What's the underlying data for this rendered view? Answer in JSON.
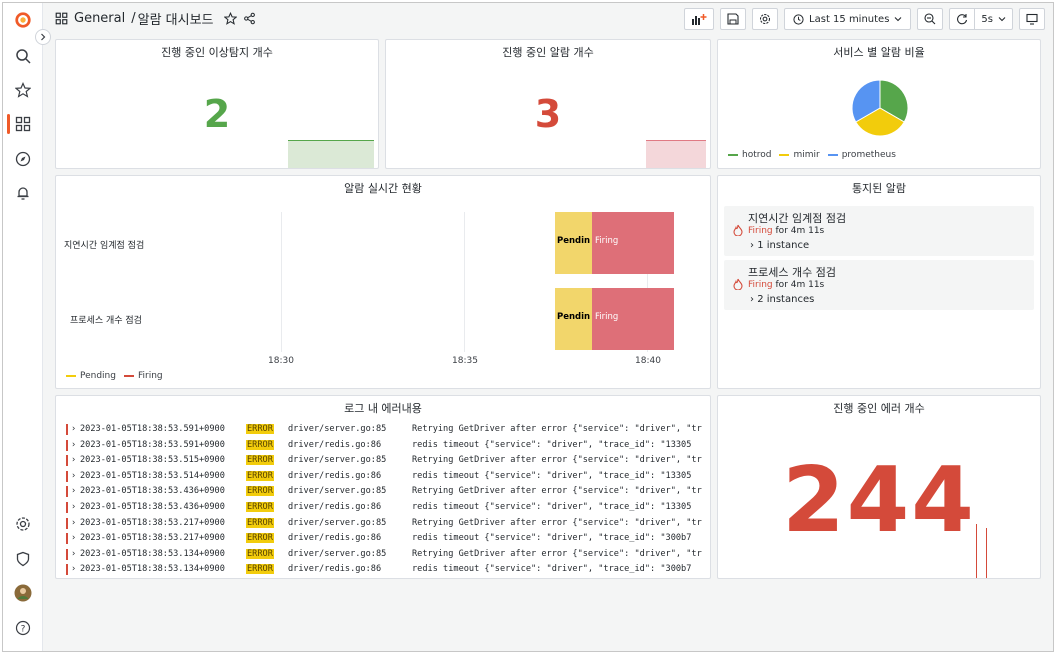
{
  "breadcrumb": {
    "folder": "General",
    "separator": "/",
    "dashboard": "알람 대시보드"
  },
  "toolbar": {
    "time_range": "Last 15 minutes",
    "refresh": "5s"
  },
  "panels": {
    "anomaly": {
      "title": "진행 중인 이상탐지 개수",
      "value": "2",
      "color": "#56a64b"
    },
    "alerts": {
      "title": "진행 중인 알람 개수",
      "value": "3",
      "color": "#d44a3a"
    },
    "service_ratio": {
      "title": "서비스 별 알람 비율",
      "legend": [
        {
          "name": "hotrod",
          "color": "#56a64b"
        },
        {
          "name": "mimir",
          "color": "#f2cc0c"
        },
        {
          "name": "prometheus",
          "color": "#5794f2"
        }
      ]
    },
    "realtime": {
      "title": "알람 실시간 현황",
      "rows": [
        {
          "label": "지연시간 임계점 점검",
          "pending": "Pendin",
          "firing": "Firing"
        },
        {
          "label": "프로세스 개수 점검",
          "pending": "Pendin",
          "firing": "Firing"
        }
      ],
      "ticks": [
        "18:30",
        "18:35",
        "18:40"
      ],
      "legend": [
        {
          "name": "Pending",
          "color": "#f2cc0c"
        },
        {
          "name": "Firing",
          "color": "#d44a3a"
        }
      ]
    },
    "notified": {
      "title": "통지된 알람",
      "items": [
        {
          "name": "지연시간 임계점 점검",
          "state": "Firing",
          "duration": "for 4m 11s",
          "instances": "1 instance"
        },
        {
          "name": "프로세스 개수 점검",
          "state": "Firing",
          "duration": "for 4m 11s",
          "instances": "2 instances"
        }
      ]
    },
    "logs": {
      "title": "로그 내 에러내용",
      "rows": [
        {
          "ts": "2023-01-05T18:38:53.591+0900",
          "level": "ERROR",
          "src": "driver/server.go:85",
          "msg": "Retrying GetDriver after error {\"service\": \"driver\", \"tr"
        },
        {
          "ts": "2023-01-05T18:38:53.591+0900",
          "level": "ERROR",
          "src": "driver/redis.go:86",
          "msg": "redis timeout   {\"service\": \"driver\", \"trace_id\": \"13305"
        },
        {
          "ts": "2023-01-05T18:38:53.515+0900",
          "level": "ERROR",
          "src": "driver/server.go:85",
          "msg": "Retrying GetDriver after error {\"service\": \"driver\", \"tr"
        },
        {
          "ts": "2023-01-05T18:38:53.514+0900",
          "level": "ERROR",
          "src": "driver/redis.go:86",
          "msg": "redis timeout   {\"service\": \"driver\", \"trace_id\": \"13305"
        },
        {
          "ts": "2023-01-05T18:38:53.436+0900",
          "level": "ERROR",
          "src": "driver/server.go:85",
          "msg": "Retrying GetDriver after error {\"service\": \"driver\", \"tr"
        },
        {
          "ts": "2023-01-05T18:38:53.436+0900",
          "level": "ERROR",
          "src": "driver/redis.go:86",
          "msg": "redis timeout   {\"service\": \"driver\", \"trace_id\": \"13305"
        },
        {
          "ts": "2023-01-05T18:38:53.217+0900",
          "level": "ERROR",
          "src": "driver/server.go:85",
          "msg": "Retrying GetDriver after error {\"service\": \"driver\", \"tr"
        },
        {
          "ts": "2023-01-05T18:38:53.217+0900",
          "level": "ERROR",
          "src": "driver/redis.go:86",
          "msg": "redis timeout   {\"service\": \"driver\", \"trace_id\": \"300b7"
        },
        {
          "ts": "2023-01-05T18:38:53.134+0900",
          "level": "ERROR",
          "src": "driver/server.go:85",
          "msg": "Retrying GetDriver after error {\"service\": \"driver\", \"tr"
        },
        {
          "ts": "2023-01-05T18:38:53.134+0900",
          "level": "ERROR",
          "src": "driver/redis.go:86",
          "msg": "redis timeout   {\"service\": \"driver\", \"trace_id\": \"300b7"
        }
      ]
    },
    "errors": {
      "title": "진행 중인 에러 개수",
      "value": "244",
      "color": "#d44a3a"
    }
  },
  "chart_data": {
    "type": "pie",
    "title": "서비스 별 알람 비율",
    "categories": [
      "hotrod",
      "mimir",
      "prometheus"
    ],
    "values": [
      1,
      1,
      1
    ],
    "colors": [
      "#56a64b",
      "#f2cc0c",
      "#5794f2"
    ]
  }
}
